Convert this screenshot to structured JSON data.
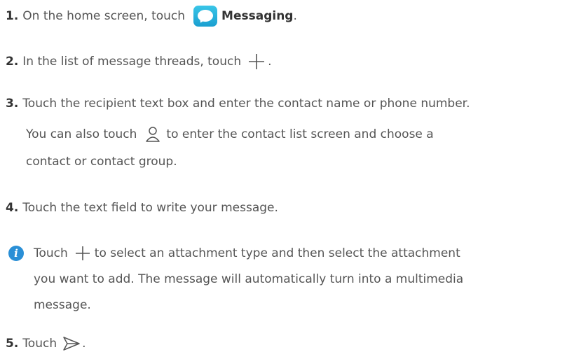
{
  "steps": {
    "s1": {
      "num": "1.",
      "text_a": "On the home screen, touch",
      "bold": "Messaging",
      "text_b": "."
    },
    "s2": {
      "num": "2.",
      "text_a": "In the list of message threads, touch",
      "text_b": "."
    },
    "s3": {
      "num": "3.",
      "text_a": "Touch the recipient text box and enter the contact name or phone number."
    },
    "s3_note": {
      "text_a": "You can also touch",
      "text_b": "to enter the contact list screen and choose a",
      "text_c": "contact or contact group."
    },
    "s4": {
      "num": "4.",
      "text_a": "Touch the text field to write your message."
    },
    "tip": {
      "text_a": "Touch",
      "text_b": "to select an attachment type and then select the attachment",
      "line2": "you want to add. The message will automatically turn into a multimedia",
      "line3": "message."
    },
    "s5": {
      "num": "5.",
      "text_a": "Touch",
      "text_b": "."
    }
  },
  "icons": {
    "app": "messaging-app-icon",
    "add": "add-icon",
    "contact": "contact-icon",
    "info": "info-icon",
    "send": "send-icon",
    "info_glyph": "i"
  },
  "colors": {
    "app_icon": "#1a9fd0",
    "info_icon": "#2a8fd6"
  }
}
